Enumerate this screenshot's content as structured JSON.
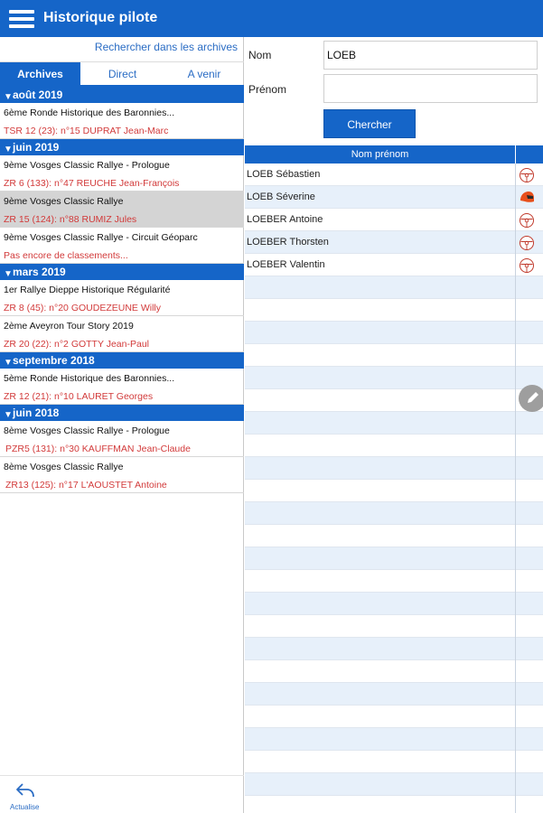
{
  "header": {
    "title": "Historique pilote"
  },
  "left": {
    "search_link": "Rechercher dans les archives",
    "tabs": [
      {
        "label": "Archives",
        "active": true
      },
      {
        "label": "Direct",
        "active": false
      },
      {
        "label": "A venir",
        "active": false
      }
    ],
    "groups": [
      {
        "month": "août 2019",
        "events": [
          {
            "name": "6ème Ronde Historique des Baronnies...",
            "result": "TSR 12 (23): n°15 DUPRAT Jean-Marc"
          }
        ]
      },
      {
        "month": "juin 2019",
        "events": [
          {
            "name": "9ème Vosges Classic Rallye - Prologue",
            "result": "ZR 6 (133): n°47 REUCHE Jean-François"
          },
          {
            "name": "9ème Vosges Classic Rallye",
            "result": "ZR 15 (124): n°88 RUMIZ Jules"
          },
          {
            "name": "9ème Vosges Classic Rallye - Circuit Géoparc",
            "result": "Pas encore de classements..."
          }
        ]
      },
      {
        "month": "mars 2019",
        "events": [
          {
            "name": "1er Rallye Dieppe Historique Régularité",
            "result": "ZR 8 (45): n°20 GOUDEZEUNE Willy"
          },
          {
            "name": "2ème Aveyron Tour Story 2019",
            "result": "ZR 20 (22): n°2 GOTTY Jean-Paul"
          }
        ]
      },
      {
        "month": "septembre 2018",
        "events": [
          {
            "name": "5ème Ronde Historique des Baronnies...",
            "result": "ZR 12 (21): n°10 LAURET Georges"
          }
        ]
      },
      {
        "month": "juin 2018",
        "events": [
          {
            "name": "8ème Vosges Classic Rallye - Prologue",
            "result": "PZR5 (131): n°30 KAUFFMAN Jean-Claude"
          },
          {
            "name": "8ème Vosges Classic Rallye",
            "result": "ZR13 (125): n°17 L'AOUSTET Antoine"
          }
        ]
      }
    ],
    "refresh_label": "Actualise"
  },
  "form": {
    "nom_label": "Nom",
    "nom_value": "LOEB",
    "prenom_label": "Prénom",
    "prenom_value": "",
    "search_button": "Chercher"
  },
  "results": {
    "column_header": "Nom prénom",
    "rows": [
      {
        "name": "LOEB Sébastien",
        "icon": "steering-wheel-icon"
      },
      {
        "name": "LOEB Séverine",
        "icon": "helmet-icon"
      },
      {
        "name": "LOEBER Antoine",
        "icon": "steering-wheel-icon"
      },
      {
        "name": "LOEBER Thorsten",
        "icon": "steering-wheel-icon"
      },
      {
        "name": "LOEBER Valentin",
        "icon": "steering-wheel-icon"
      }
    ]
  },
  "colors": {
    "primary": "#1565c8",
    "result_red": "#d23a3a",
    "helmet": "#e8501c"
  }
}
